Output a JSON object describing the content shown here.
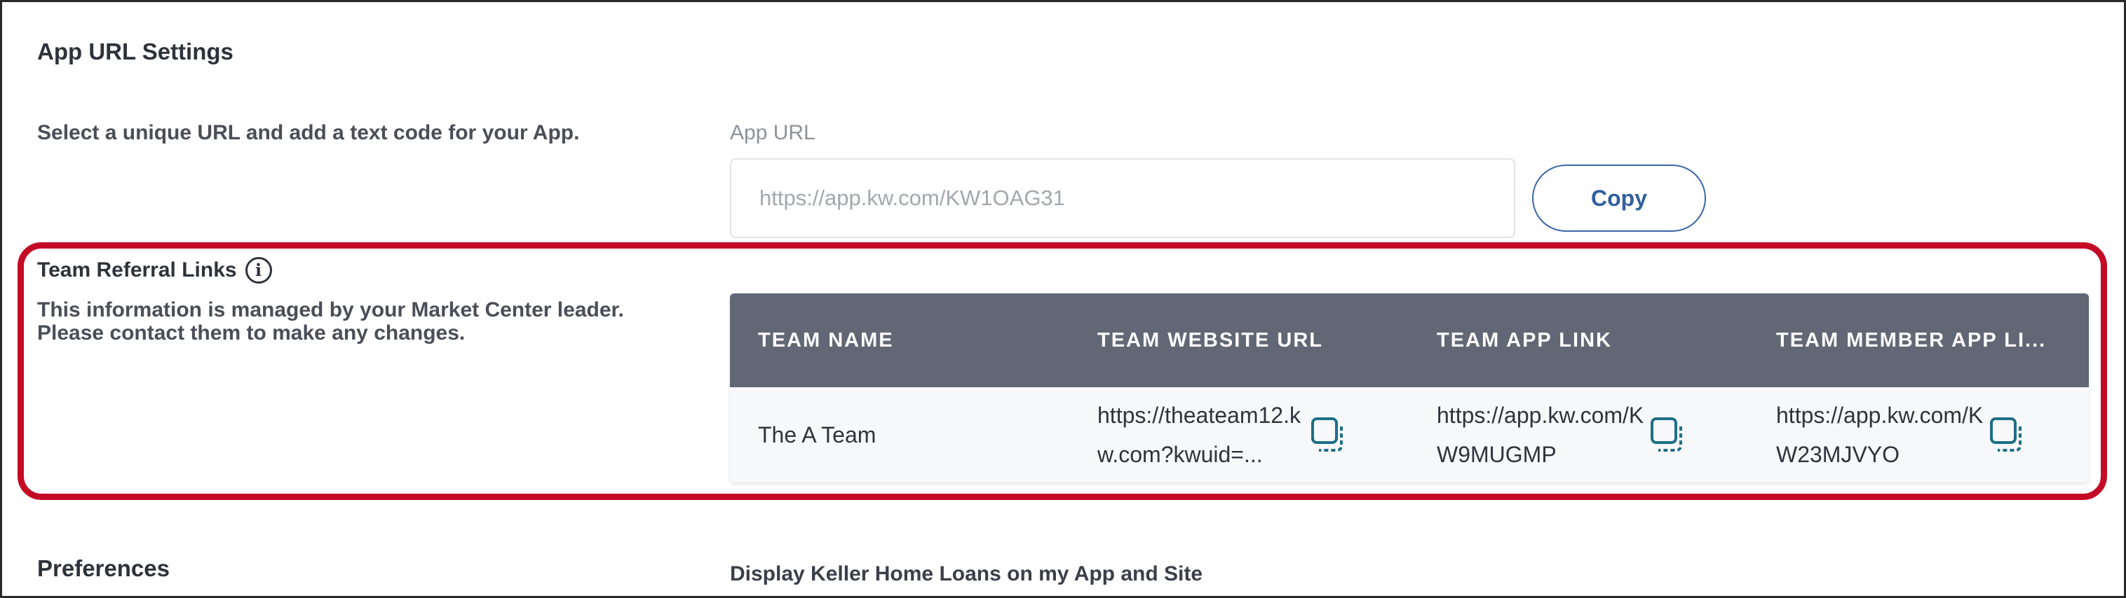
{
  "app_url_settings": {
    "title": "App URL Settings",
    "description": "Select a unique URL and add a text code for your App.",
    "field_label": "App URL",
    "url_placeholder": "https://app.kw.com/KW1OAG31",
    "copy_label": "Copy"
  },
  "team_referral_links": {
    "title": "Team Referral Links",
    "info_glyph": "i",
    "description_line1": "This information is managed by your Market Center leader.",
    "description_line2": "Please contact them to make any changes.",
    "columns": [
      "TEAM NAME",
      "TEAM WEBSITE URL",
      "TEAM APP LINK",
      "TEAM MEMBER APP LI..."
    ],
    "rows": [
      {
        "team_name": "The A Team",
        "team_website_url": "https://theateam12.kw.com?kwuid=...",
        "team_app_link": "https://app.kw.com/KW9MUGMP",
        "team_member_app_link": "https://app.kw.com/KW23MJVYO"
      }
    ]
  },
  "preferences": {
    "title": "Preferences",
    "description": "Display Keller Home Loans on my App and Site"
  },
  "colors": {
    "highlight": "#c40b26",
    "table_header": "#626776",
    "accent": "#2f5f9e",
    "copy_icon": "#1e6f87"
  },
  "icons": [
    "info-icon",
    "copy-icon"
  ]
}
